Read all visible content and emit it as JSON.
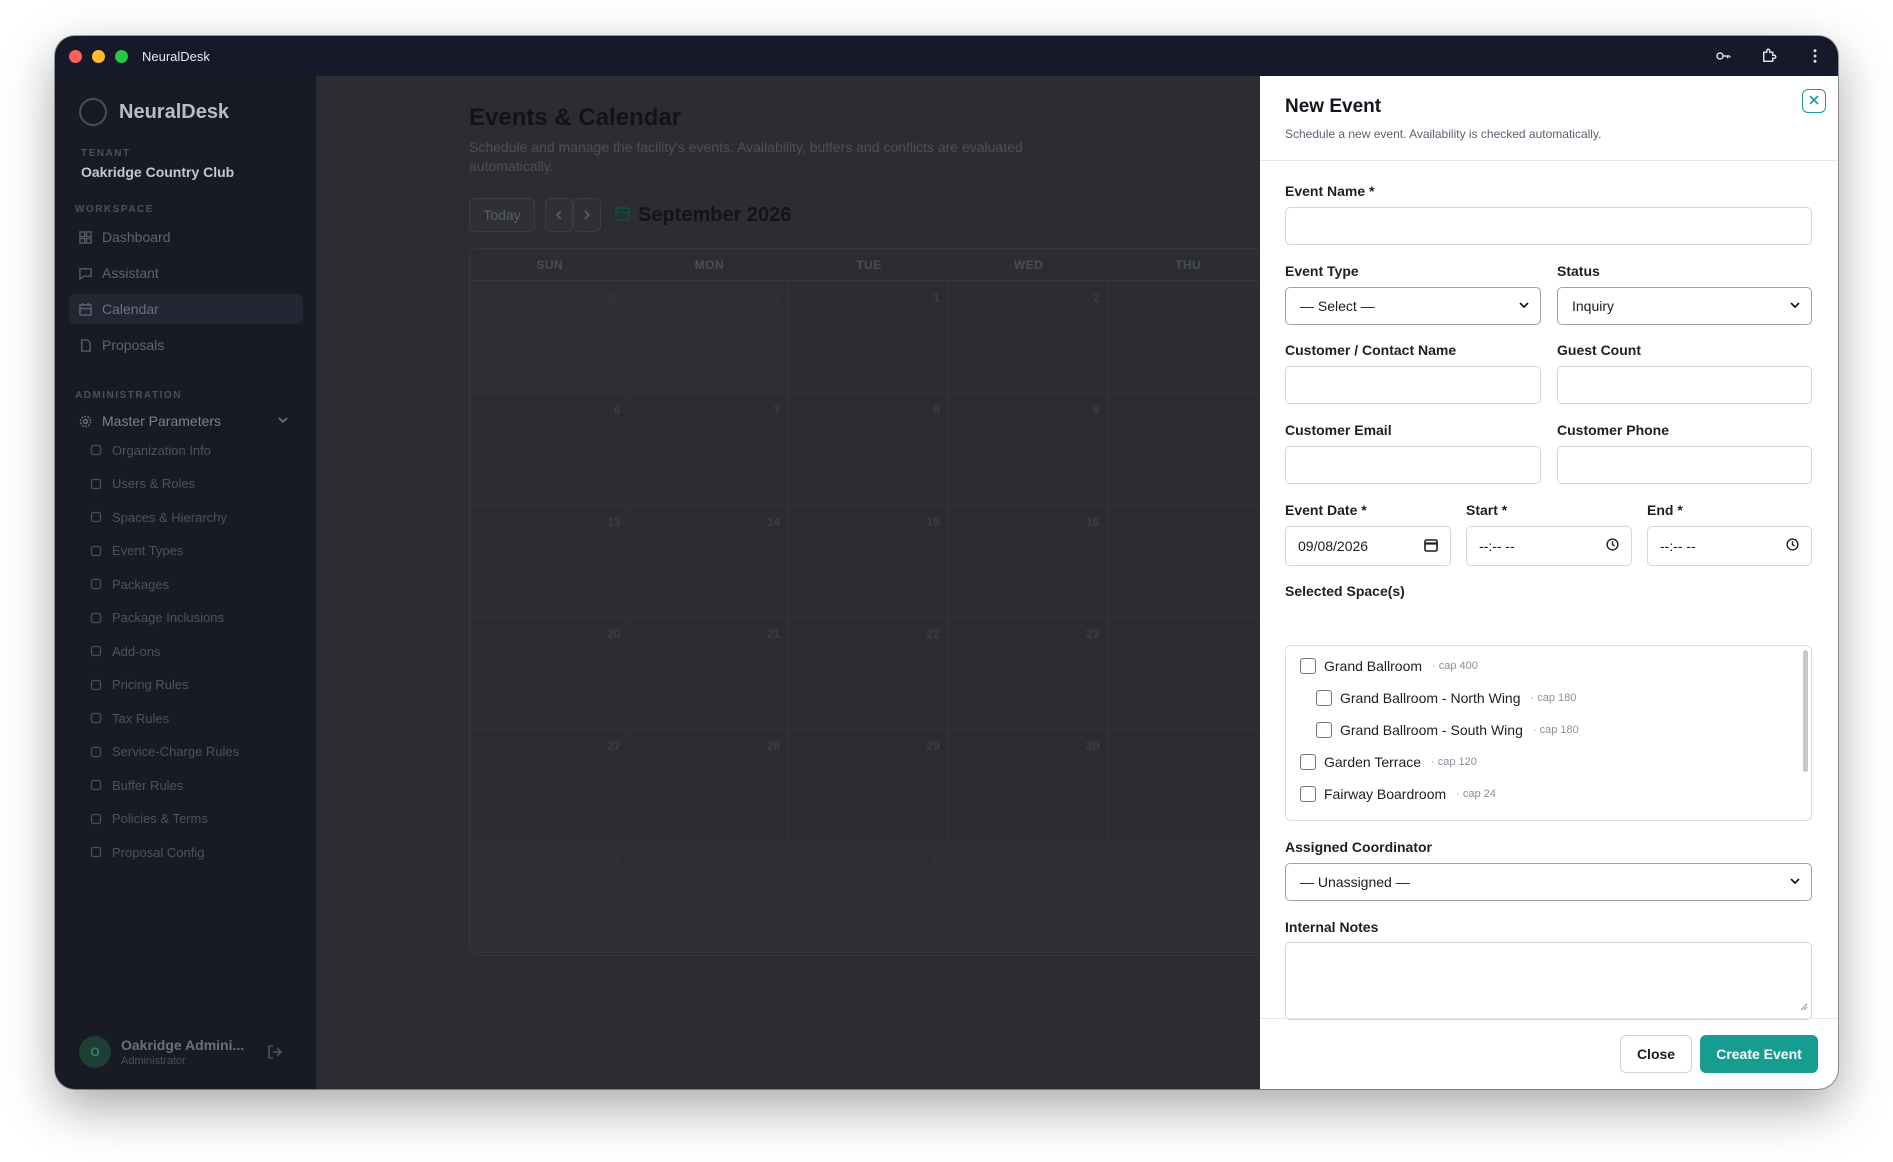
{
  "window": {
    "title": "NeuralDesk"
  },
  "sidebar": {
    "brand": "NeuralDesk",
    "tenant_label": "TENANT",
    "tenant_name": "Oakridge Country Club",
    "workspace_label": "WORKSPACE",
    "workspace_items": [
      {
        "label": "Dashboard",
        "icon": "grid-icon"
      },
      {
        "label": "Assistant",
        "icon": "chat-icon"
      },
      {
        "label": "Calendar",
        "icon": "calendar-icon"
      },
      {
        "label": "Proposals",
        "icon": "document-icon"
      }
    ],
    "admin_label": "ADMINISTRATION",
    "master_label": "Master Parameters",
    "master_items": [
      "Organization Info",
      "Users & Roles",
      "Spaces & Hierarchy",
      "Event Types",
      "Packages",
      "Package Inclusions",
      "Add-ons",
      "Pricing Rules",
      "Tax Rules",
      "Service-Charge Rules",
      "Buffer Rules",
      "Policies & Terms",
      "Proposal Config"
    ],
    "user": {
      "initial": "O",
      "name": "Oakridge Admini...",
      "role": "Administrator"
    }
  },
  "main": {
    "title": "Events & Calendar",
    "subtitle": "Schedule and manage the facility's events. Availability, buffers and conflicts are evaluated automatically.",
    "today": "Today",
    "month": "September 2026",
    "weekdays": [
      "SUN",
      "MON",
      "TUE",
      "WED",
      "THU"
    ],
    "weeks": [
      [
        "30",
        "31",
        "1",
        "2",
        ""
      ],
      [
        "6",
        "7",
        "8",
        "9",
        ""
      ],
      [
        "13",
        "14",
        "15",
        "16",
        ""
      ],
      [
        "20",
        "21",
        "22",
        "23",
        ""
      ],
      [
        "27",
        "28",
        "29",
        "30",
        ""
      ],
      [
        "4",
        "5",
        "6",
        "7",
        ""
      ]
    ]
  },
  "drawer": {
    "title": "New Event",
    "subtitle": "Schedule a new event. Availability is checked automatically.",
    "event_name_label": "Event Name *",
    "event_name_value": "",
    "event_type_label": "Event Type",
    "event_type_value": "— Select —",
    "status_label": "Status",
    "status_value": "Inquiry",
    "contact_label": "Customer / Contact Name",
    "guest_label": "Guest Count",
    "email_label": "Customer Email",
    "phone_label": "Customer Phone",
    "date_label": "Event Date *",
    "date_value": "09/08/2026",
    "start_label": "Start *",
    "start_value": "--:-- --",
    "end_label": "End *",
    "end_value": "--:-- --",
    "spaces_label": "Selected Space(s)",
    "spaces": [
      {
        "name": "Grand Ballroom",
        "cap": "· cap 400",
        "indent": false
      },
      {
        "name": "Grand Ballroom - North Wing",
        "cap": "· cap 180",
        "indent": true
      },
      {
        "name": "Grand Ballroom - South Wing",
        "cap": "· cap 180",
        "indent": true
      },
      {
        "name": "Garden Terrace",
        "cap": "· cap 120",
        "indent": false
      },
      {
        "name": "Fairway Boardroom",
        "cap": "· cap 24",
        "indent": false
      }
    ],
    "coordinator_label": "Assigned Coordinator",
    "coordinator_value": "— Unassigned —",
    "notes_label": "Internal Notes",
    "close_btn": "Close",
    "create_btn": "Create Event"
  },
  "colors": {
    "accent": "#169d8f",
    "titlebar": "#15192a",
    "sidebar": "#181b23",
    "overlay": "#2b2d31"
  }
}
